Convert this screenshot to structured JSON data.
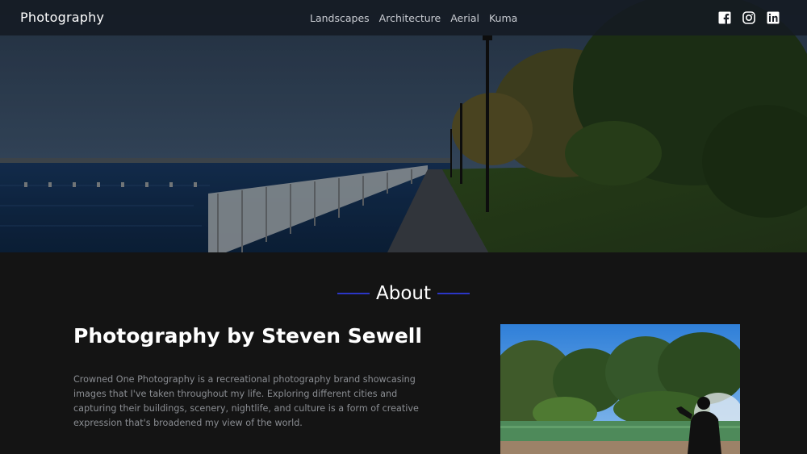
{
  "navbar": {
    "brand": "Photography",
    "links": [
      "Landscapes",
      "Architecture",
      "Aerial",
      "Kuma"
    ],
    "socials": [
      "facebook-icon",
      "instagram-icon",
      "linkedin-icon"
    ]
  },
  "about": {
    "heading": "About",
    "title": "Photography by Steven Sewell",
    "description": "Crowned One Photography is a recreational photography brand showcasing images that I've taken throughout my life. Exploring different cities and capturing their buildings, scenery, nightlife, and culture is a form of creative expression that's broadened my view of the world."
  },
  "colors": {
    "accent": "#2b36c6",
    "background": "#141414",
    "body_text": "#8a8d92"
  }
}
